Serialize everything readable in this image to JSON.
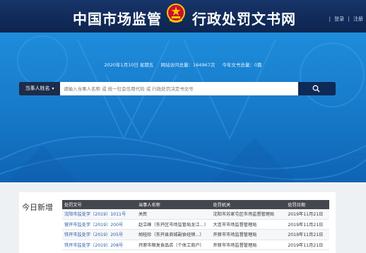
{
  "header": {
    "title_left": "中国市场监管",
    "title_right": "行政处罚文书网",
    "links": [
      "登录",
      "注册"
    ]
  },
  "stats": {
    "date": "2020年1月10日 星期五",
    "visits": "网站访问总量：164967次",
    "docs": "今年文书总量：0篇"
  },
  "search": {
    "type_label": "当事人姓名",
    "placeholder": "请输入当事人名称 或 统一社会信用代码 或 行政处罚决定书文号"
  },
  "news": {
    "title": "今日新增",
    "columns": [
      "处罚文号",
      "当事人名称",
      "处罚机关",
      "处罚日期"
    ],
    "rows": [
      [
        "沈阳市监处字〔2019〕1011号",
        "关民",
        "沈阳市苏家屯区市场监督管理局",
        "2019年11月21日"
      ],
      [
        "营开市监处字〔2019〕200号",
        "赵立峰（东开区市场监管局龙江…）",
        "大连市市场监督管理局",
        "2019年11月21日"
      ],
      [
        "铁开市监处字〔2019〕205号",
        "胡桂珍（东开县商城副食经销…）",
        "开原市市场监督管理局",
        "2019年11月21日"
      ],
      [
        "铁开市监处字〔2019〕208号",
        "开原市顺发食品店（个体工商户）",
        "开原市市场监督管理局",
        "2019年11月21日"
      ]
    ]
  },
  "colors": {
    "header_bg": "#102a58",
    "hero_blue": "#1679c9",
    "search_btn": "#0e2a57"
  },
  "icons": [
    "national-emblem-icon",
    "search-icon",
    "chevron-down-icon"
  ]
}
